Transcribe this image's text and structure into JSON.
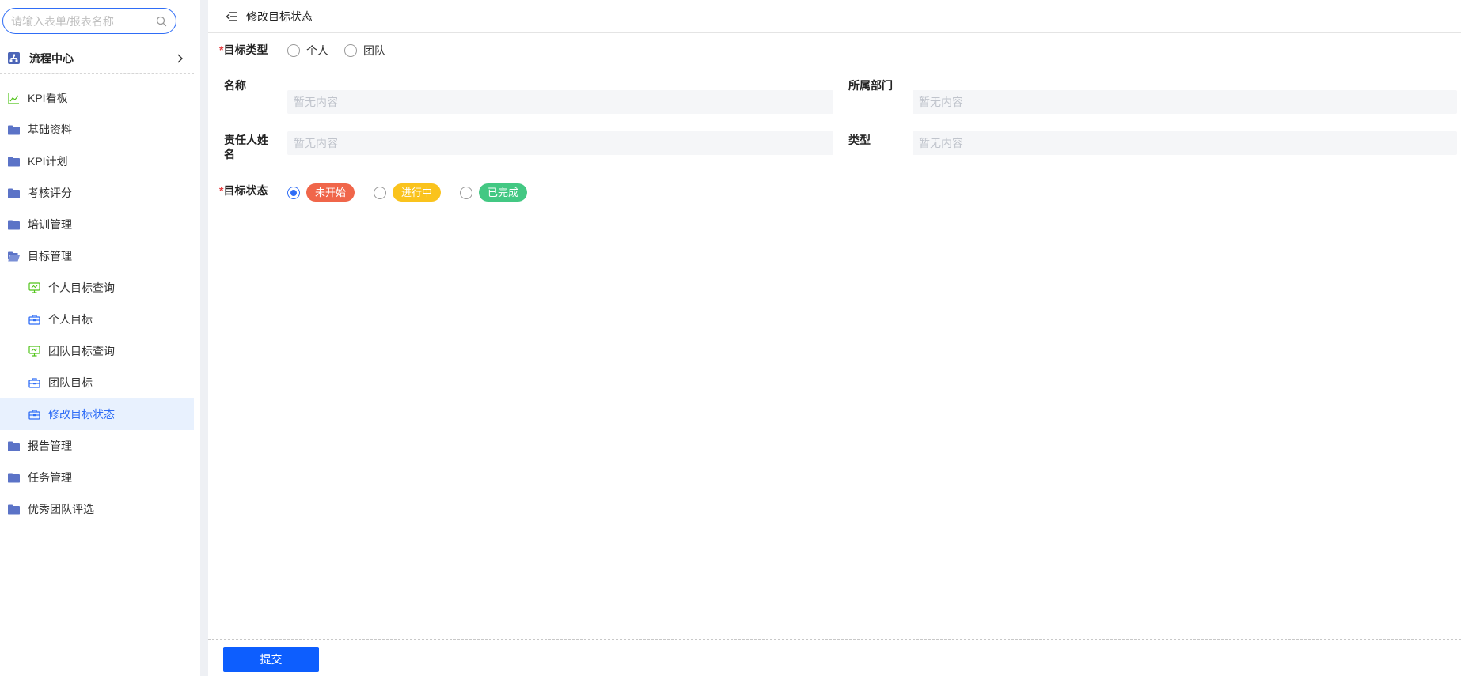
{
  "search": {
    "placeholder": "请输入表单/报表名称"
  },
  "flow_center": {
    "label": "流程中心"
  },
  "nav": {
    "items": [
      {
        "label": "KPI看板",
        "icon": "chart-line-icon",
        "level": 0,
        "active": false
      },
      {
        "label": "基础资料",
        "icon": "folder-icon",
        "level": 0,
        "active": false
      },
      {
        "label": "KPI计划",
        "icon": "folder-icon",
        "level": 0,
        "active": false
      },
      {
        "label": "考核评分",
        "icon": "folder-icon",
        "level": 0,
        "active": false
      },
      {
        "label": "培训管理",
        "icon": "folder-icon",
        "level": 0,
        "active": false
      },
      {
        "label": "目标管理",
        "icon": "folder-open-icon",
        "level": 0,
        "active": false
      },
      {
        "label": "个人目标查询",
        "icon": "report-icon",
        "level": 1,
        "active": false
      },
      {
        "label": "个人目标",
        "icon": "form-icon",
        "level": 1,
        "active": false
      },
      {
        "label": "团队目标查询",
        "icon": "report-icon",
        "level": 1,
        "active": false
      },
      {
        "label": "团队目标",
        "icon": "form-icon",
        "level": 1,
        "active": false
      },
      {
        "label": "修改目标状态",
        "icon": "form-icon",
        "level": 1,
        "active": true
      },
      {
        "label": "报告管理",
        "icon": "folder-icon",
        "level": 0,
        "active": false
      },
      {
        "label": "任务管理",
        "icon": "folder-icon",
        "level": 0,
        "active": false
      },
      {
        "label": "优秀团队评选",
        "icon": "folder-icon",
        "level": 0,
        "active": false
      }
    ]
  },
  "header": {
    "title": "修改目标状态"
  },
  "form": {
    "required_mark": "*",
    "target_type": {
      "label": "目标类型",
      "options": [
        "个人",
        "团队"
      ]
    },
    "name": {
      "label": "名称",
      "placeholder": "暂无内容"
    },
    "department": {
      "label": "所属部门",
      "placeholder": "暂无内容"
    },
    "owner": {
      "label": "责任人姓名",
      "placeholder": "暂无内容"
    },
    "type": {
      "label": "类型",
      "placeholder": "暂无内容"
    },
    "status": {
      "label": "目标状态",
      "selected": "未开始",
      "options": [
        {
          "label": "未开始",
          "color": "#f0664a"
        },
        {
          "label": "进行中",
          "color": "#fac31d"
        },
        {
          "label": "已完成",
          "color": "#43c883"
        }
      ]
    }
  },
  "footer": {
    "submit_label": "提交"
  },
  "colors": {
    "accent": "#2f6df6",
    "primary_button": "#0d5efe",
    "folder": "#5b73c7",
    "chart": "#52c41a"
  }
}
